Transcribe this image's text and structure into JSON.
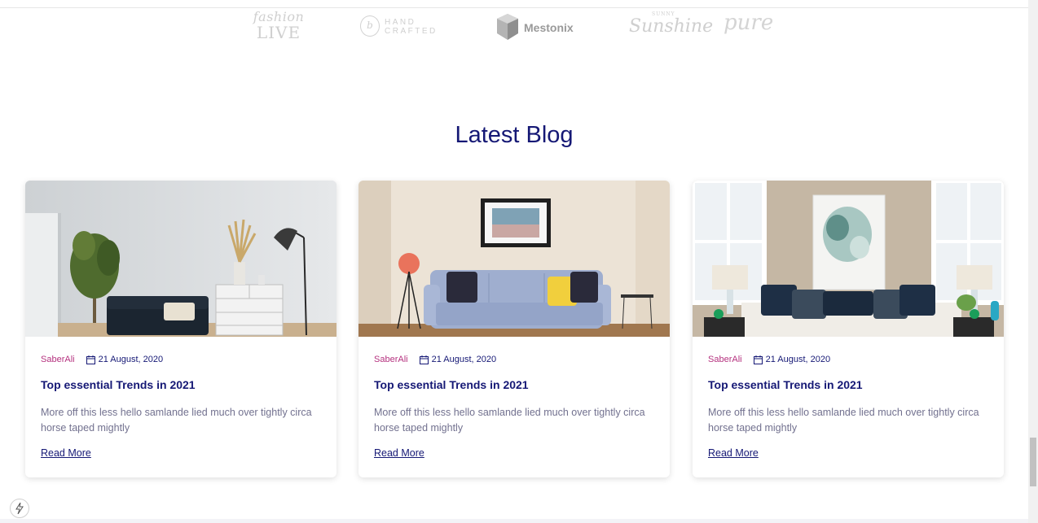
{
  "brands": {
    "fashion_top": "fashion",
    "fashion_bottom": "LIVE",
    "hand_letter": "b",
    "hand_line1": "HAND",
    "hand_line2": "CRAFTED",
    "mestonix": "Mestonix",
    "sunshine_small": "SUNNY",
    "sunshine": "Sunshine",
    "pure": "pure"
  },
  "section": {
    "title": "Latest Blog"
  },
  "posts": [
    {
      "author": "SaberAli",
      "date": "21 August, 2020",
      "title": "Top essential Trends in 2021",
      "description": "More off this less hello samlande lied much over tightly circa horse taped mightly",
      "link": "Read More"
    },
    {
      "author": "SaberAli",
      "date": "21 August, 2020",
      "title": "Top essential Trends in 2021",
      "description": "More off this less hello samlande lied much over tightly circa horse taped mightly",
      "link": "Read More"
    },
    {
      "author": "SaberAli",
      "date": "21 August, 2020",
      "title": "Top essential Trends in 2021",
      "description": "More off this less hello samlande lied much over tightly circa horse taped mightly",
      "link": "Read More"
    }
  ],
  "icons": {
    "calendar": "calendar-icon",
    "bolt": "lightning-icon"
  },
  "colors": {
    "heading": "#151875",
    "author": "#b5327f",
    "text": "#72718f"
  }
}
